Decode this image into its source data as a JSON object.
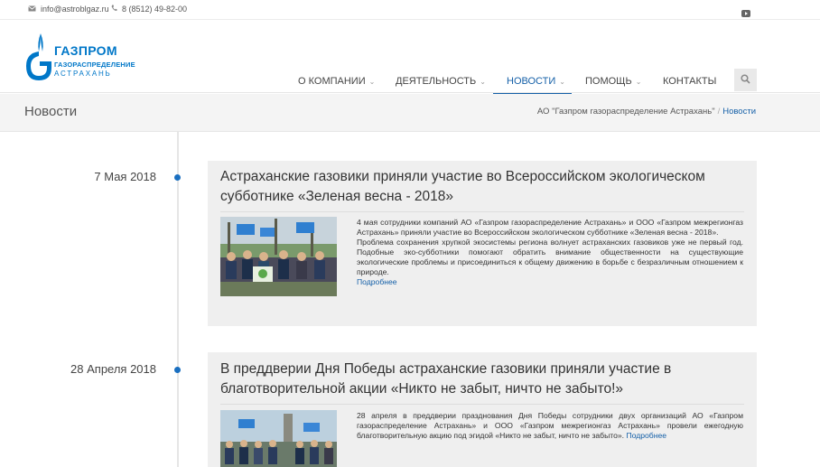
{
  "topbar": {
    "email": "info@astroblgaz.ru",
    "phone": "8 (8512) 49-82-00"
  },
  "logo": {
    "line1": "ГАЗПРОМ",
    "line2": "ГАЗОРАСПРЕДЕЛЕНИЕ",
    "line3": "АСТРАХАНЬ"
  },
  "nav": {
    "items": [
      {
        "label": "О компании"
      },
      {
        "label": "Деятельность"
      },
      {
        "label": "Новости"
      },
      {
        "label": "Помощь"
      },
      {
        "label": "Контакты"
      }
    ]
  },
  "page": {
    "title": "Новости",
    "breadcrumb": {
      "home": "АО \"Газпром газораспределение Астрахань\"",
      "separator": "/",
      "current": "Новости"
    }
  },
  "news": [
    {
      "date": "7 Мая 2018",
      "title": "Астраханские газовики приняли участие во Всероссийском экологическом субботнике «Зеленая весна - 2018»",
      "para1": "4 мая сотрудники компаний  АО «Газпром газораспределение Астрахань» и ООО «Газпром межрегионгаз Астрахань» приняли участие во Всероссийском экологическом субботнике «Зеленая весна - 2018».",
      "para2": "Проблема сохранения хрупкой экосистемы региона волнует астраханских газовиков уже не первый год. Подобные эко-субботники помогают обратить внимание общественности на существующие экологические проблемы и присоединиться к общему движению в борьбе с безразличным отношением к природе.",
      "more": "Подробнее"
    },
    {
      "date": "28 Апреля 2018",
      "title": "В преддверии Дня Победы астраханские газовики приняли участие в благотворительной акции «Никто не забыт, ничто не забыто!»",
      "para1": "28 апреля в преддверии празднования Дня Победы сотрудники двух организаций  АО «Газпром газораспределение Астрахань» и ООО «Газпром межрегионгаз Астрахань»  провели ежегодную благотворительную акцию под эгидой «Никто не забыт, ничто не забыто».",
      "more": "Подробнее"
    }
  ],
  "colors": {
    "brand_blue": "#0077c8",
    "accent_blue": "#1560a8",
    "timeline_dot": "#1a6fc0",
    "card_bg": "#efefef"
  },
  "icons": {
    "email": "envelope-icon",
    "phone": "phone-icon",
    "youtube": "youtube-icon",
    "search": "search-icon",
    "dropdown": "chevron-down-icon"
  }
}
